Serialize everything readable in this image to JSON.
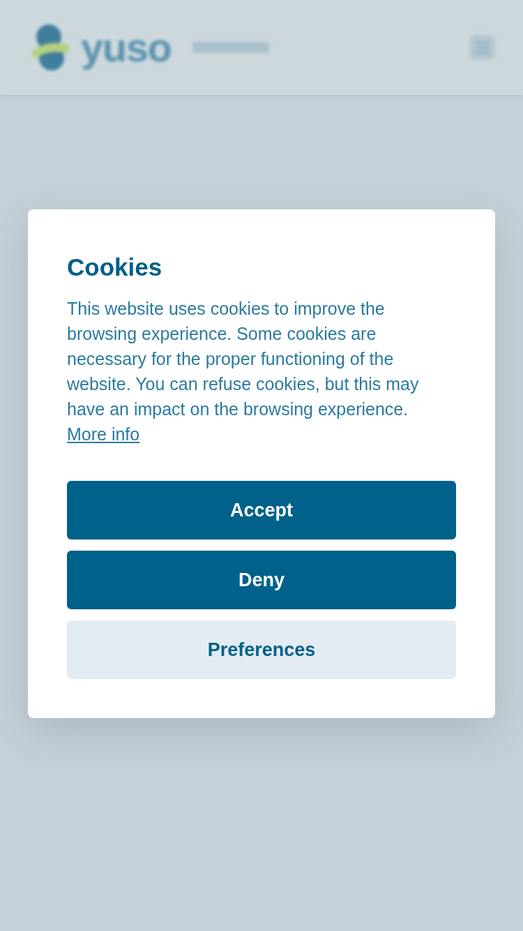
{
  "header": {
    "logo_text": "yuso"
  },
  "cookie_dialog": {
    "title": "Cookies",
    "message": "This website uses cookies to improve the browsing experience. Some cookies are necessary for the proper functioning of the website. You can refuse cookies, but this may have an impact on the browsing experience.",
    "link": "More info",
    "buttons": [
      {
        "label": "Accept",
        "kind": "primary"
      },
      {
        "label": "Deny",
        "kind": "primary"
      },
      {
        "label": "Preferences",
        "kind": "secondary"
      }
    ]
  }
}
